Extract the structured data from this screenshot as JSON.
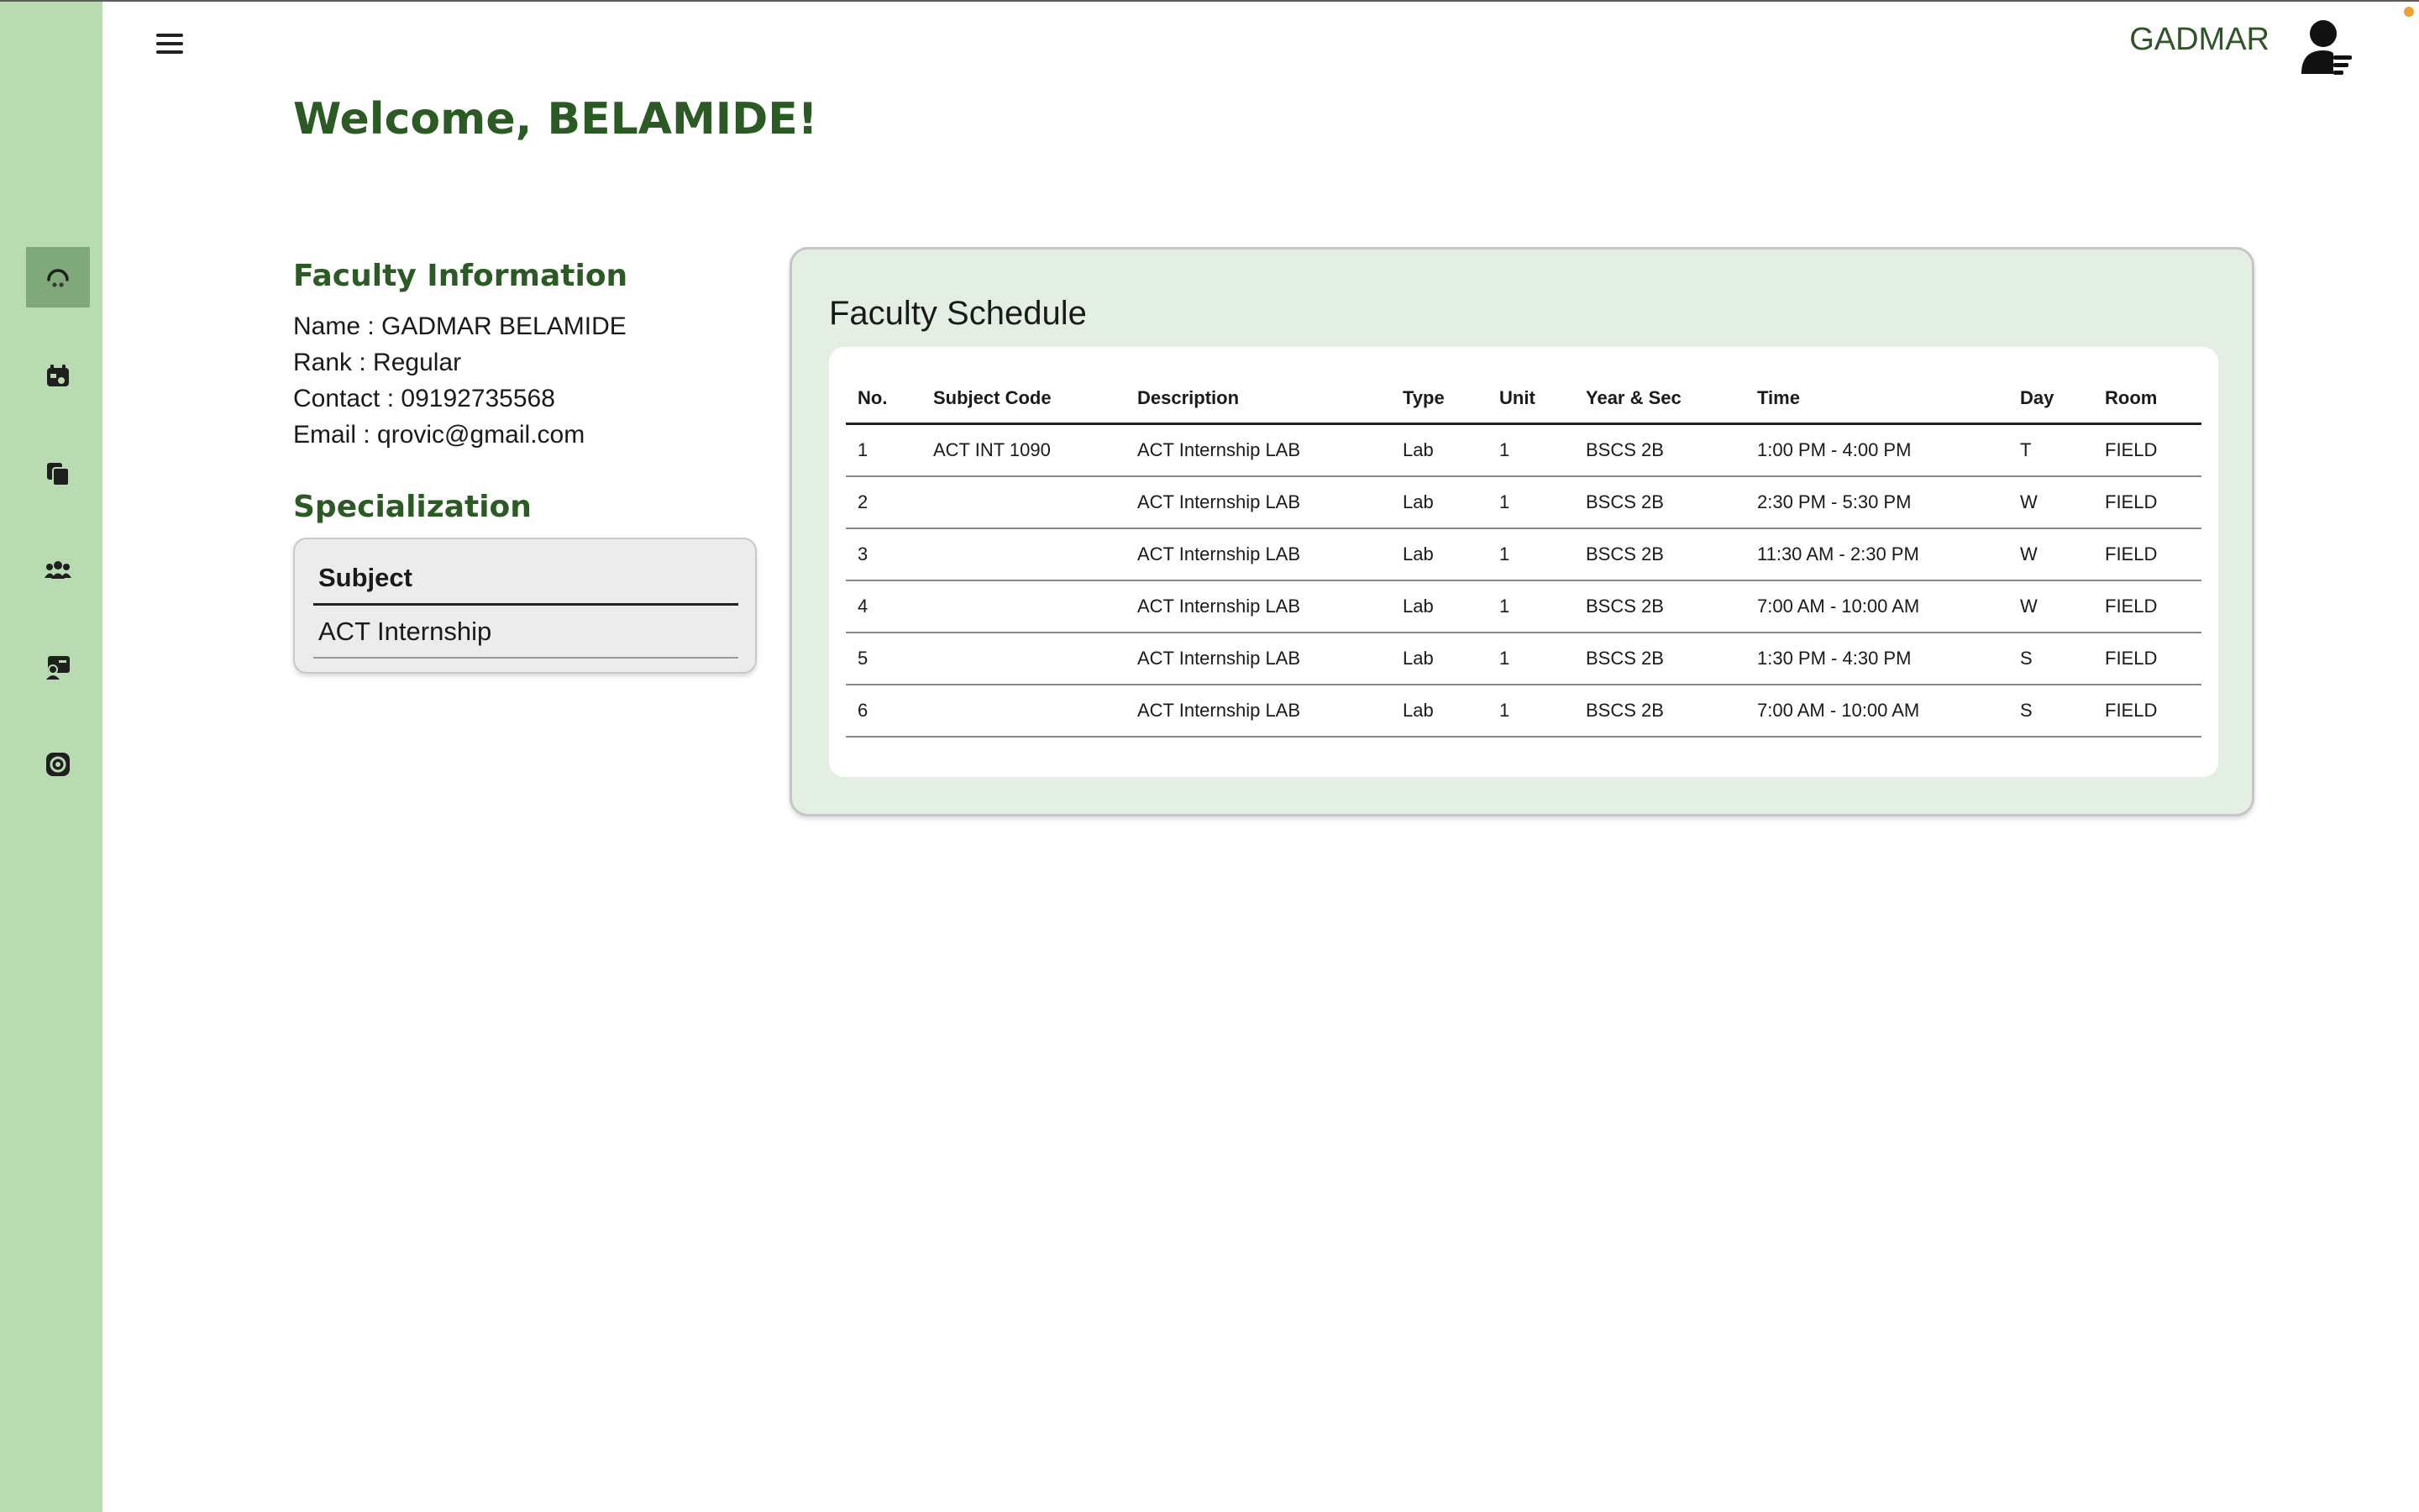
{
  "header": {
    "user_name": "GADMAR",
    "welcome": "Welcome, BELAMIDE!"
  },
  "sidebar": {
    "items": [
      {
        "icon": "dashboard-icon",
        "active": true
      },
      {
        "icon": "schedule-icon",
        "active": false
      },
      {
        "icon": "files-icon",
        "active": false
      },
      {
        "icon": "users-icon",
        "active": false
      },
      {
        "icon": "class-icon",
        "active": false
      },
      {
        "icon": "settings-icon",
        "active": false
      }
    ]
  },
  "faculty_info": {
    "title": "Faculty Information",
    "name": "Name : GADMAR BELAMIDE",
    "rank": "Rank : Regular",
    "contact": "Contact : 09192735568",
    "email": "Email : qrovic@gmail.com"
  },
  "specialization": {
    "title": "Specialization",
    "header": "Subject",
    "subject": "ACT Internship"
  },
  "schedule": {
    "title": "Faculty Schedule",
    "columns": [
      "No.",
      "Subject Code",
      "Description",
      "Type",
      "Unit",
      "Year & Sec",
      "Time",
      "Day",
      "Room"
    ],
    "rows": [
      [
        "1",
        "ACT INT 1090",
        "ACT Internship LAB",
        "Lab",
        "1",
        "BSCS 2B",
        "1:00 PM - 4:00 PM",
        "T",
        "FIELD"
      ],
      [
        "2",
        "",
        "ACT Internship LAB",
        "Lab",
        "1",
        "BSCS 2B",
        "2:30 PM - 5:30 PM",
        "W",
        "FIELD"
      ],
      [
        "3",
        "",
        "ACT Internship LAB",
        "Lab",
        "1",
        "BSCS 2B",
        "11:30 AM - 2:30 PM",
        "W",
        "FIELD"
      ],
      [
        "4",
        "",
        "ACT Internship LAB",
        "Lab",
        "1",
        "BSCS 2B",
        "7:00 AM - 10:00 AM",
        "W",
        "FIELD"
      ],
      [
        "5",
        "",
        "ACT Internship LAB",
        "Lab",
        "1",
        "BSCS 2B",
        "1:30 PM - 4:30 PM",
        "S",
        "FIELD"
      ],
      [
        "6",
        "",
        "ACT Internship LAB",
        "Lab",
        "1",
        "BSCS 2B",
        "7:00 AM - 10:00 AM",
        "S",
        "FIELD"
      ]
    ]
  },
  "colors": {
    "sidebar_bg": "#b8dbb2",
    "sidebar_active": "#7fa97a",
    "accent_green": "#2b5a24",
    "schedule_card_bg": "#e3efe3"
  }
}
